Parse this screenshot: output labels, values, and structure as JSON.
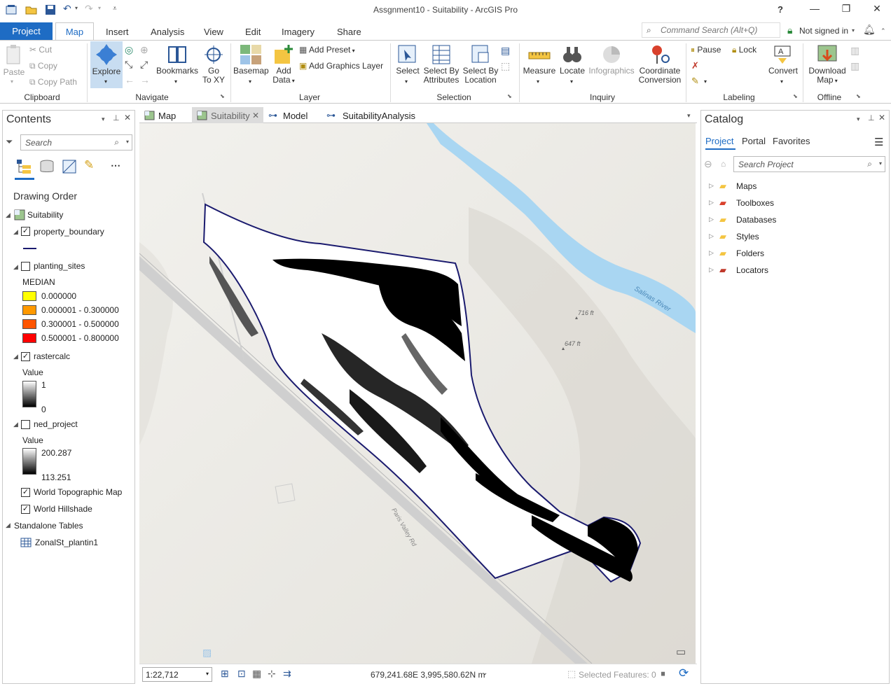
{
  "app": {
    "window_title": "Assgnment10 - Suitability - ArcGIS Pro",
    "help": "?"
  },
  "ribbon_tabs": {
    "project": "Project",
    "map": "Map",
    "insert": "Insert",
    "analysis": "Analysis",
    "view": "View",
    "edit": "Edit",
    "imagery": "Imagery",
    "share": "Share"
  },
  "command_search": {
    "placeholder": "Command Search (Alt+Q)"
  },
  "account": {
    "status": "Not signed in"
  },
  "clipboard": {
    "paste": "Paste",
    "cut": "Cut",
    "copy": "Copy",
    "copy_path": "Copy Path",
    "group": "Clipboard"
  },
  "navigate": {
    "explore": "Explore",
    "bookmarks": "Bookmarks",
    "goto_line1": "Go",
    "goto_line2": "To XY",
    "group": "Navigate"
  },
  "layer": {
    "basemap": "Basemap",
    "add_data_line1": "Add",
    "add_data_line2": "Data",
    "add_preset": "Add Preset",
    "add_graphics_layer": "Add Graphics Layer",
    "group": "Layer"
  },
  "selection": {
    "select": "Select",
    "select_by_attr_line1": "Select By",
    "select_by_attr_line2": "Attributes",
    "select_by_loc_line1": "Select By",
    "select_by_loc_line2": "Location",
    "group": "Selection"
  },
  "inquiry": {
    "measure": "Measure",
    "locate": "Locate",
    "infographics": "Infographics",
    "coord_line1": "Coordinate",
    "coord_line2": "Conversion",
    "group": "Inquiry"
  },
  "labeling": {
    "pause": "Pause",
    "lock": "Lock",
    "convert": "Convert",
    "group": "Labeling"
  },
  "offline": {
    "download_line1": "Download",
    "download_line2": "Map",
    "group": "Offline"
  },
  "contents": {
    "title": "Contents",
    "search_placeholder": "Search",
    "drawing_order": "Drawing Order",
    "map_name": "Suitability",
    "layers": {
      "property_boundary": "property_boundary",
      "planting_sites": "planting_sites",
      "median_label": "MEDIAN",
      "classes": [
        {
          "label": "0.000000",
          "color": "#ffff00"
        },
        {
          "label": "0.000001 - 0.300000",
          "color": "#ff9900"
        },
        {
          "label": "0.300001 - 0.500000",
          "color": "#ff5500"
        },
        {
          "label": "0.500001 - 0.800000",
          "color": "#ff0000"
        }
      ],
      "rastercalc": "rastercalc",
      "rastercalc_value": "Value",
      "rastercalc_high": "1",
      "rastercalc_low": "0",
      "ned_project": "ned_project",
      "ned_value": "Value",
      "ned_high": "200.287",
      "ned_low": "113.251",
      "world_topo": "World Topographic Map",
      "world_hillshade": "World Hillshade",
      "standalone_tables": "Standalone Tables",
      "zonal_table": "ZonalSt_plantin1"
    }
  },
  "view_tabs": {
    "map": "Map",
    "suitability": "Suitability",
    "model": "Model",
    "suitability_analysis": "SuitabilityAnalysis"
  },
  "map": {
    "river_label": "Salinas River",
    "road_label": "Paris Valley Rd",
    "elev1": "716 ft",
    "elev2": "647 ft"
  },
  "status": {
    "scale": "1:22,712",
    "coordinates": "679,241.68E 3,995,580.62N m",
    "selected_features": "Selected Features: 0"
  },
  "catalog": {
    "title": "Catalog",
    "tabs": {
      "project": "Project",
      "portal": "Portal",
      "favorites": "Favorites"
    },
    "search_placeholder": "Search Project",
    "items": [
      {
        "label": "Maps"
      },
      {
        "label": "Toolboxes"
      },
      {
        "label": "Databases"
      },
      {
        "label": "Styles"
      },
      {
        "label": "Folders"
      },
      {
        "label": "Locators"
      }
    ]
  }
}
